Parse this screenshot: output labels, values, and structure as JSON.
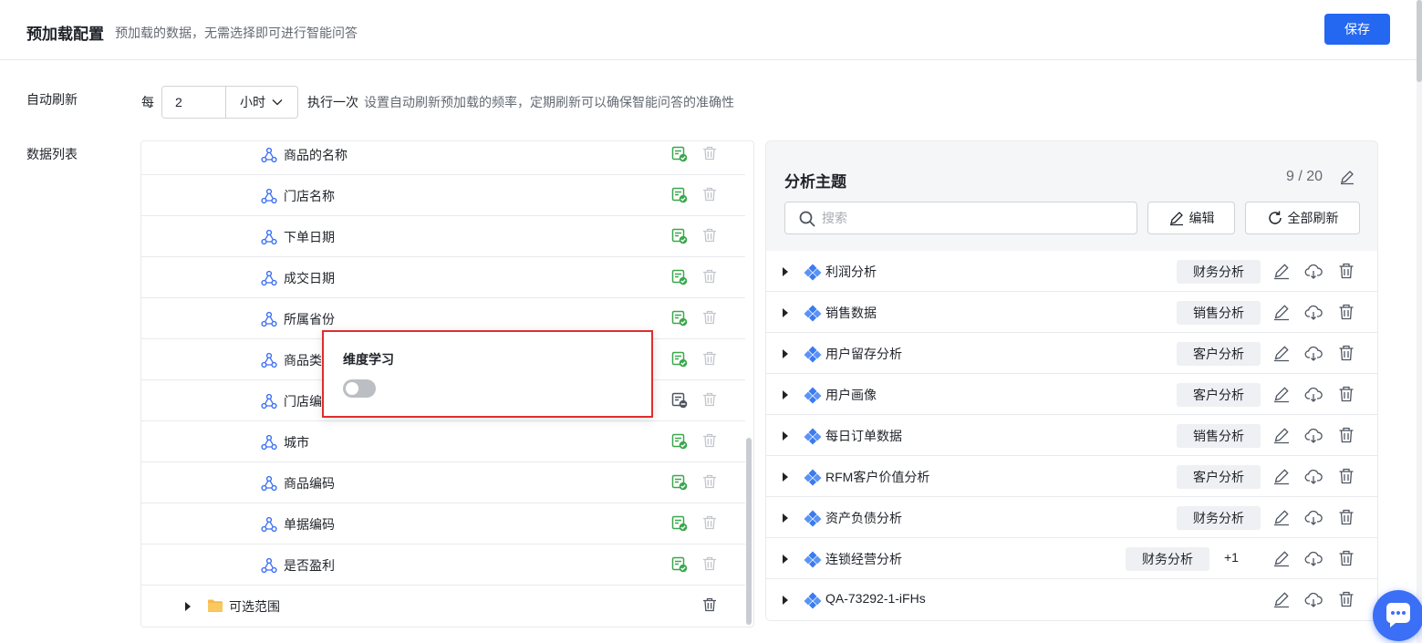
{
  "header": {
    "title": "预加载配置",
    "subtitle": "预加载的数据，无需选择即可进行智能问答",
    "save_label": "保存"
  },
  "auto_refresh": {
    "label": "自动刷新",
    "prefix": "每",
    "interval_value": "2",
    "unit": "小时",
    "suffix": "执行一次",
    "hint": "设置自动刷新预加载的频率，定期刷新可以确保智能问答的准确性"
  },
  "data_list": {
    "label": "数据列表",
    "rows": [
      {
        "label": "商品的名称",
        "status": "check"
      },
      {
        "label": "门店名称",
        "status": "check"
      },
      {
        "label": "下单日期",
        "status": "check"
      },
      {
        "label": "成交日期",
        "status": "check"
      },
      {
        "label": "所属省份",
        "status": "check"
      },
      {
        "label": "商品类",
        "status": "check"
      },
      {
        "label": "门店编",
        "status": "minus"
      },
      {
        "label": "城市",
        "status": "check"
      },
      {
        "label": "商品编码",
        "status": "check"
      },
      {
        "label": "单据编码",
        "status": "check"
      },
      {
        "label": "是否盈利",
        "status": "check"
      }
    ],
    "folder": {
      "label": "可选范围"
    }
  },
  "popover": {
    "title": "维度学习",
    "toggle_on": false
  },
  "topics": {
    "title": "分析主题",
    "count": "9 / 20",
    "search_placeholder": "搜索",
    "edit_label": "编辑",
    "refresh_all_label": "全部刷新",
    "items": [
      {
        "label": "利润分析",
        "tag": "财务分析",
        "more": ""
      },
      {
        "label": "销售数据",
        "tag": "销售分析",
        "more": ""
      },
      {
        "label": "用户留存分析",
        "tag": "客户分析",
        "more": ""
      },
      {
        "label": "用户画像",
        "tag": "客户分析",
        "more": ""
      },
      {
        "label": "每日订单数据",
        "tag": "销售分析",
        "more": ""
      },
      {
        "label": "RFM客户价值分析",
        "tag": "客户分析",
        "more": ""
      },
      {
        "label": "资产负债分析",
        "tag": "财务分析",
        "more": ""
      },
      {
        "label": "连锁经营分析",
        "tag": "财务分析",
        "more": "+1"
      },
      {
        "label": "QA-73292-1-iFHs",
        "tag": "",
        "more": ""
      }
    ]
  },
  "colors": {
    "primary": "#2468f2",
    "success": "#3aa74d",
    "highlight_border": "#e02d2d",
    "topic_icon": "#3a7bf0"
  }
}
